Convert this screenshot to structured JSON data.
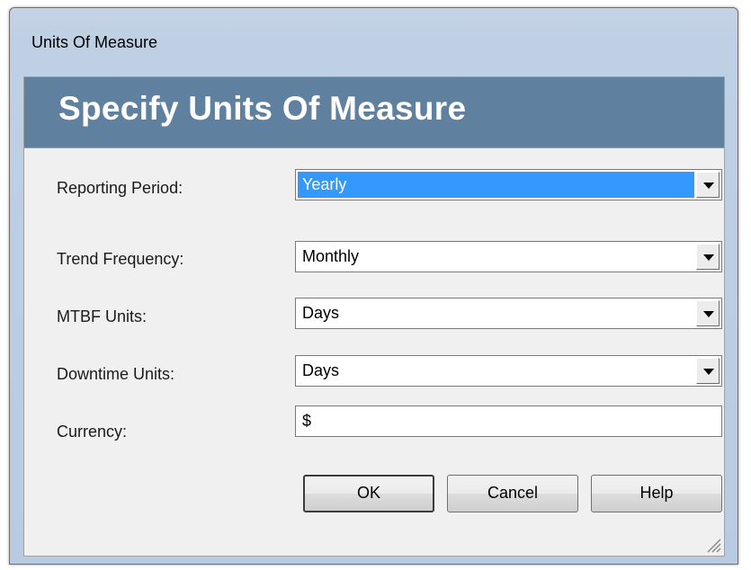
{
  "window": {
    "title": "Units Of Measure"
  },
  "banner": {
    "title": "Specify Units Of Measure"
  },
  "fields": {
    "reporting_period": {
      "label": "Reporting Period:",
      "value": "Yearly"
    },
    "trend_frequency": {
      "label": "Trend Frequency:",
      "value": "Monthly"
    },
    "mtbf_units": {
      "label": "MTBF Units:",
      "value": "Days"
    },
    "downtime_units": {
      "label": "Downtime Units:",
      "value": "Days"
    },
    "currency": {
      "label": "Currency:",
      "value": "$"
    }
  },
  "buttons": {
    "ok": "OK",
    "cancel": "Cancel",
    "help": "Help"
  },
  "icons": {
    "dropdown": "chevron-down-icon",
    "resize": "resize-grip-icon"
  },
  "colors": {
    "banner": "#60809f",
    "selection": "#3399ff",
    "dialog_bg": "#f0f0f0"
  }
}
